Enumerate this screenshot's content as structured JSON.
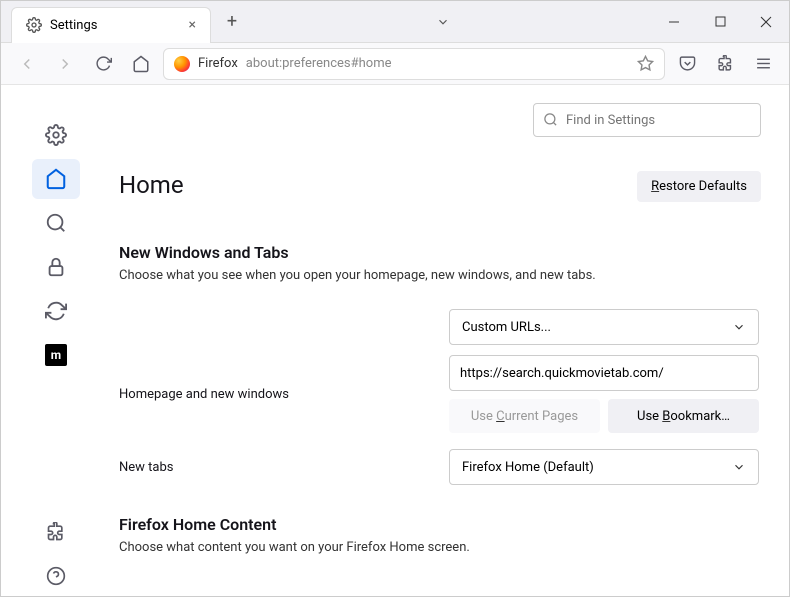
{
  "titlebar": {
    "tab_label": "Settings"
  },
  "toolbar": {
    "browser_label": "Firefox",
    "url": "about:preferences#home"
  },
  "find": {
    "placeholder": "Find in Settings"
  },
  "page": {
    "title": "Home",
    "restore_label": "Restore Defaults"
  },
  "nwt": {
    "heading": "New Windows and Tabs",
    "description": "Choose what you see when you open your homepage, new windows, and new tabs.",
    "homepage_label": "Homepage and new windows",
    "homepage_select": "Custom URLs...",
    "homepage_url": "https://search.quickmovietab.com/",
    "use_current": "Use Current Pages",
    "use_bookmark": "Use Bookmark…",
    "newtabs_label": "New tabs",
    "newtabs_select": "Firefox Home (Default)"
  },
  "fhc": {
    "heading": "Firefox Home Content",
    "description": "Choose what content you want on your Firefox Home screen."
  }
}
